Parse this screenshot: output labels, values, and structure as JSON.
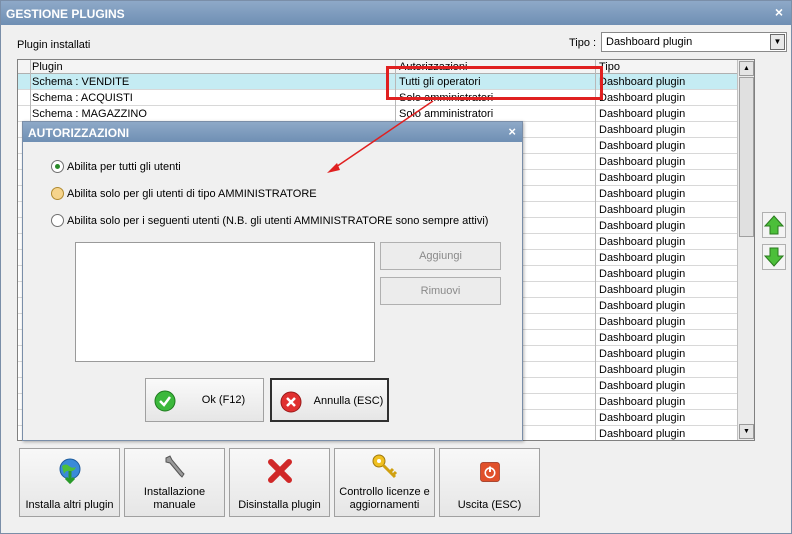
{
  "window": {
    "title": "GESTIONE PLUGINS",
    "close_glyph": "×"
  },
  "installed_label": "Plugin installati",
  "tipo": {
    "label": "Tipo :",
    "value": "Dashboard plugin",
    "arrow": "▼"
  },
  "grid": {
    "columns": [
      "Plugin",
      "Autorizzazioni",
      "Tipo"
    ],
    "rows": [
      {
        "plugin": "Schema : VENDITE",
        "auth": "Tutti gli operatori",
        "tipo": "Dashboard plugin"
      },
      {
        "plugin": "Schema : ACQUISTI",
        "auth": "Solo amministratori",
        "tipo": "Dashboard plugin"
      },
      {
        "plugin": "Schema : MAGAZZINO",
        "auth": "Solo amministratori",
        "tipo": "Dashboard plugin"
      },
      {
        "plugin": "",
        "auth": "",
        "tipo": "Dashboard plugin"
      },
      {
        "plugin": "",
        "auth": "",
        "tipo": "Dashboard plugin"
      },
      {
        "plugin": "",
        "auth": "",
        "tipo": "Dashboard plugin"
      },
      {
        "plugin": "",
        "auth": "",
        "tipo": "Dashboard plugin"
      },
      {
        "plugin": "",
        "auth": "",
        "tipo": "Dashboard plugin"
      },
      {
        "plugin": "",
        "auth": "",
        "tipo": "Dashboard plugin"
      },
      {
        "plugin": "",
        "auth": "",
        "tipo": "Dashboard plugin"
      },
      {
        "plugin": "",
        "auth": "",
        "tipo": "Dashboard plugin"
      },
      {
        "plugin": "",
        "auth": "",
        "tipo": "Dashboard plugin"
      },
      {
        "plugin": "",
        "auth": "",
        "tipo": "Dashboard plugin"
      },
      {
        "plugin": "",
        "auth": "",
        "tipo": "Dashboard plugin"
      },
      {
        "plugin": "",
        "auth": "",
        "tipo": "Dashboard plugin"
      },
      {
        "plugin": "",
        "auth": "",
        "tipo": "Dashboard plugin"
      },
      {
        "plugin": "",
        "auth": "",
        "tipo": "Dashboard plugin"
      },
      {
        "plugin": "",
        "auth": "",
        "tipo": "Dashboard plugin"
      },
      {
        "plugin": "",
        "auth": "",
        "tipo": "Dashboard plugin"
      },
      {
        "plugin": "",
        "auth": "",
        "tipo": "Dashboard plugin"
      },
      {
        "plugin": "",
        "auth": "",
        "tipo": "Dashboard plugin"
      },
      {
        "plugin": "",
        "auth": "",
        "tipo": "Dashboard plugin"
      },
      {
        "plugin": "",
        "auth": "",
        "tipo": "Dashboard plugin"
      }
    ],
    "scroll_up": "▲",
    "scroll_down": "▼"
  },
  "side_buttons": {
    "up_icon": "arrow-up-icon",
    "down_icon": "arrow-down-icon"
  },
  "bottom_buttons": [
    {
      "label": "Installa altri plugin",
      "icon": "globe-download-icon"
    },
    {
      "label": "Installazione manuale",
      "icon": "wrench-icon"
    },
    {
      "label": "Disinstalla plugin",
      "icon": "red-x-icon"
    },
    {
      "label": "Controllo licenze e aggiornamenti",
      "icon": "key-icon"
    },
    {
      "label": "Uscita (ESC)",
      "icon": "power-icon"
    }
  ],
  "dialog": {
    "title": "AUTORIZZAZIONI",
    "close_glyph": "×",
    "options": [
      {
        "label": "Abilita per tutti gli utenti",
        "selected": true
      },
      {
        "label": "Abilita solo per gli utenti di tipo AMMINISTRATORE",
        "selected": false
      },
      {
        "label": "Abilita solo per i seguenti utenti (N.B. gli utenti AMMINISTRATORE sono sempre attivi)",
        "selected": false
      }
    ],
    "add_label": "Aggiungi",
    "remove_label": "Rimuovi",
    "ok_label": "Ok (F12)",
    "cancel_label": "Annulla (ESC)"
  },
  "colors": {
    "selected_row": "#c5ecf3",
    "annotation": "#e02020",
    "titlebar": "#7a98bd"
  }
}
